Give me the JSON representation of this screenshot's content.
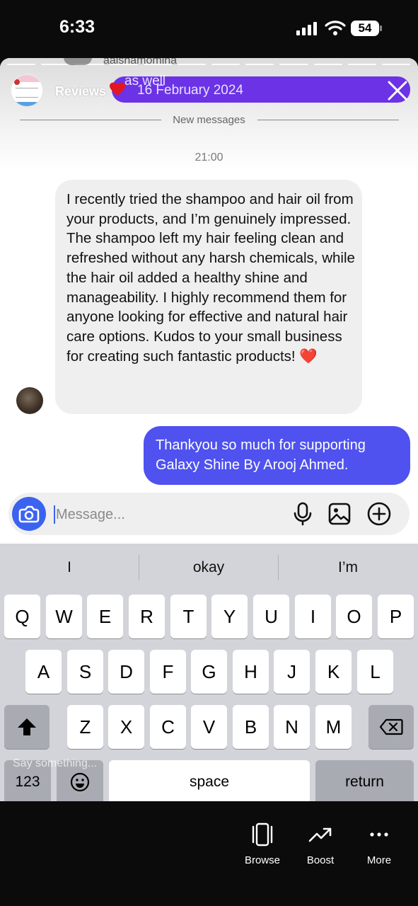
{
  "status_bar": {
    "time": "6:33",
    "battery": "54"
  },
  "story": {
    "ghost_username": "aaishamomina",
    "title": "Reviews",
    "banner_date": "16 February 2024",
    "banner_ghost_text": "as well"
  },
  "chat": {
    "new_messages_label": "New messages",
    "timestamp": "21:00",
    "received_message": "I recently tried the shampoo and hair oil from your products, and I’m genuinely impressed. The shampoo left my hair feeling clean and refreshed without any harsh chemicals, while the hair oil added a healthy shine and manageability. I highly recommend them for anyone looking for effective and natural hair care options. Kudos to your small business for creating such fantastic products! ❤️",
    "sent_message": "Thankyou so much for supporting Galaxy Shine By Arooj Ahmed."
  },
  "composer": {
    "placeholder": "Message..."
  },
  "keyboard": {
    "suggestions": [
      "I",
      "okay",
      "I’m"
    ],
    "row1": [
      "Q",
      "W",
      "E",
      "R",
      "T",
      "Y",
      "U",
      "I",
      "O",
      "P"
    ],
    "row2": [
      "A",
      "S",
      "D",
      "F",
      "G",
      "H",
      "J",
      "K",
      "L"
    ],
    "row3": [
      "Z",
      "X",
      "C",
      "V",
      "B",
      "N",
      "M"
    ],
    "numbers_key": "123",
    "space_key": "space",
    "return_key": "return",
    "overlay_text": "Say something..."
  },
  "bottom_tools": [
    {
      "label": "Browse",
      "icon": "phone-outline-icon"
    },
    {
      "label": "Boost",
      "icon": "trend-up-icon"
    },
    {
      "label": "More",
      "icon": "more-dots-icon"
    }
  ],
  "colors": {
    "sent_bubble": "#4f52ef",
    "banner": "#6b32e6",
    "camera_button": "#3b63f0"
  }
}
